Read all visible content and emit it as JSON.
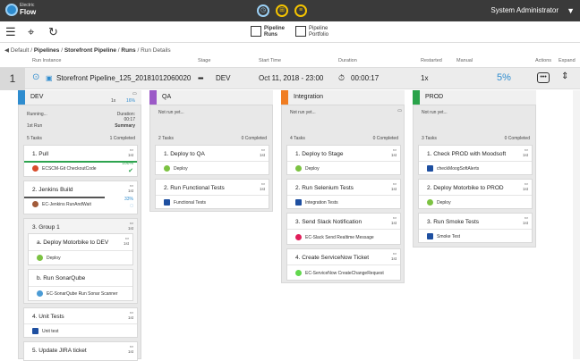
{
  "topbar": {
    "logo_line1": "Electric",
    "logo_line2": "Flow",
    "user": "System Administrator"
  },
  "toolbar": {
    "tab1_line1": "Pipeline",
    "tab1_line2": "Runs",
    "tab2_line1": "Pipeline",
    "tab2_line2": "Portfolio"
  },
  "breadcrumb": {
    "items": [
      "Default",
      "Pipelines",
      "Storefront Pipeline",
      "Runs",
      "Run Details"
    ]
  },
  "headers": {
    "run_instance": "Run Instance",
    "stage": "Stage",
    "start_time": "Start Time",
    "duration": "Duration",
    "restarted": "Restarted",
    "manual": "Manual",
    "actions": "Actions",
    "expand": "Expand"
  },
  "run": {
    "number": "1",
    "name": "Storefront Pipeline_125_20181012060020",
    "stage": "DEV",
    "start_time": "Oct 11, 2018 - 23:00",
    "duration": "00:00:17",
    "restarted": "1x",
    "progress": "5%"
  },
  "stages": {
    "dev": {
      "name": "DEV",
      "restart": "1x",
      "pct": "16%",
      "status": "Running...",
      "dur_label": "Duration:",
      "dur": "00:17",
      "first_run": "1st Run",
      "summary": "Summary",
      "tasks_count": "5 Tasks",
      "completed": "1 Completed",
      "t1": {
        "title": "1.  Pull",
        "nth": "1st",
        "plugin": "ECSCM-Git CheckoutCode",
        "pct": "100%"
      },
      "t2": {
        "title": "2.  Jenkins Build",
        "nth": "1st",
        "plugin": "EC-Jenkins RunAndWait",
        "pct": "33%"
      },
      "g3": {
        "title": "3.  Group 1",
        "nth": "1st"
      },
      "ta": {
        "title": "a.  Deploy Motorbike to DEV",
        "nth": "1st",
        "plugin": "Deploy"
      },
      "tb": {
        "title": "b.  Run SonarQube",
        "nth": "1st",
        "plugin": "EC-SonarQube Run Sonar Scanner"
      },
      "t4": {
        "title": "4.  Unit Tests",
        "nth": "1st",
        "plugin": "Unit test"
      },
      "t5": {
        "title": "5.  Update JIRA ticket",
        "nth": "1st"
      }
    },
    "qa": {
      "name": "QA",
      "status": "Not run yet...",
      "tasks_count": "2 Tasks",
      "completed": "0 Completed",
      "t1": {
        "title": "1.  Deploy to QA",
        "nth": "1st",
        "plugin": "Deploy"
      },
      "t2": {
        "title": "2.  Run Functional Tests",
        "nth": "1st",
        "plugin": "Functional Tests"
      }
    },
    "int": {
      "name": "Integration",
      "status": "Not run yet...",
      "tasks_count": "4 Tasks",
      "completed": "0 Completed",
      "t1": {
        "title": "1.  Deploy to Stage",
        "nth": "1st",
        "plugin": "Deploy"
      },
      "t2": {
        "title": "2.  Run Selenium Tests",
        "nth": "1st",
        "plugin": "Integration Tests"
      },
      "t3": {
        "title": "3.  Send Slack Notification",
        "nth": "1st",
        "plugin": "EC-Slack Send Realtime Message"
      },
      "t4": {
        "title": "4.  Create ServiceNow Ticket",
        "nth": "1st",
        "plugin": "EC-ServiceNow CreateChangeRequest"
      }
    },
    "prod": {
      "name": "PROD",
      "status": "Not run yet...",
      "tasks_count": "3 Tasks",
      "completed": "0 Completed",
      "t1": {
        "title": "1.  Check PROD with Moodsoft",
        "nth": "1st",
        "plugin": "checkMoogSoftAlerts"
      },
      "t2": {
        "title": "2.  Deploy Motorbike to PROD",
        "nth": "1st",
        "plugin": "Deploy"
      },
      "t3": {
        "title": "3.  Run Smoke Tests",
        "nth": "1st",
        "plugin": "Smoke Test"
      }
    }
  },
  "colors": {
    "dev": "#2e8ccf",
    "qa": "#9b59c7",
    "int": "#f07d22",
    "prod": "#2aa34a"
  }
}
